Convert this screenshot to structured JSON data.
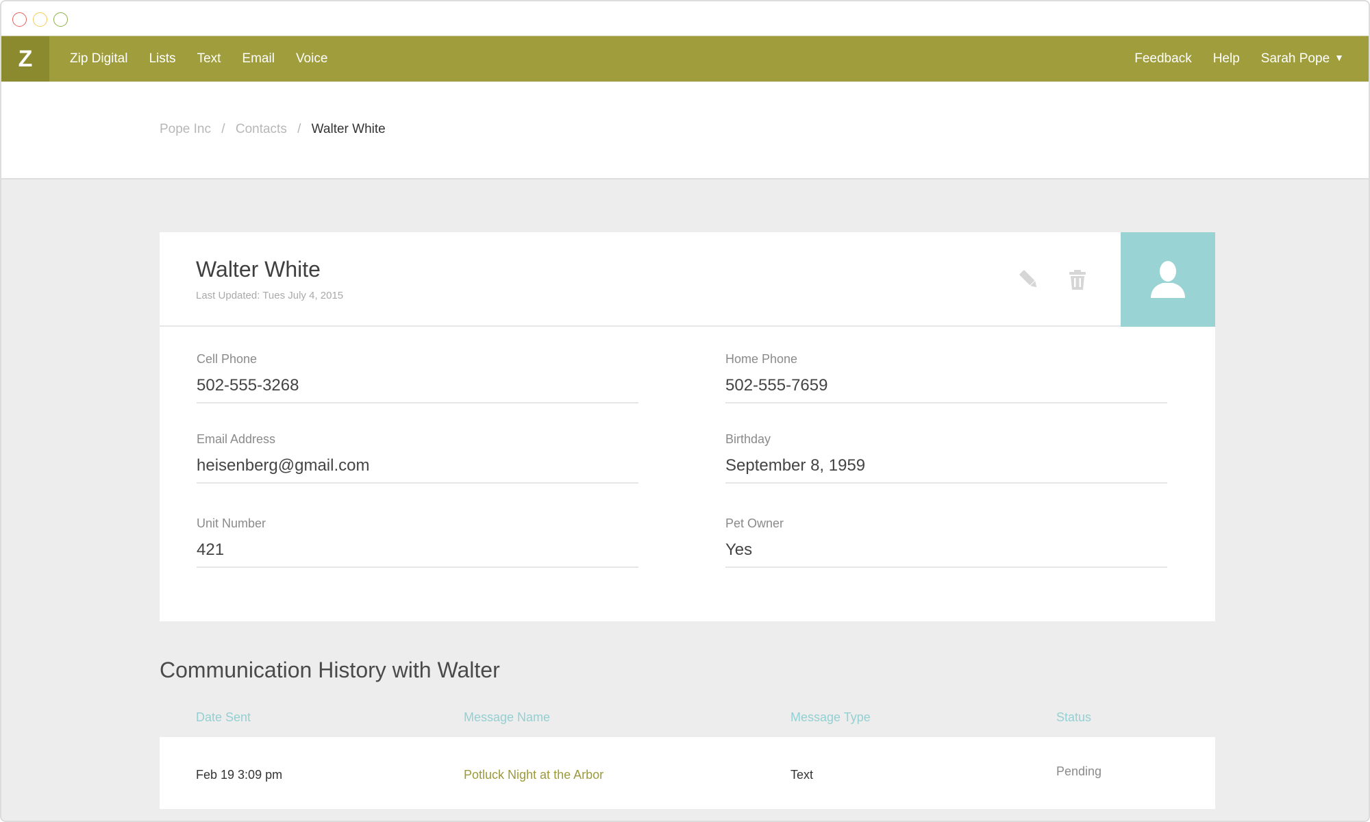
{
  "window": {
    "controls": [
      "close",
      "minimize",
      "maximize"
    ]
  },
  "nav": {
    "logo": "Z",
    "left_items": [
      {
        "label": "Zip Digital"
      },
      {
        "label": "Lists"
      },
      {
        "label": "Text"
      },
      {
        "label": "Email"
      },
      {
        "label": "Voice"
      }
    ],
    "right_items": {
      "feedback": "Feedback",
      "help": "Help",
      "user": "Sarah Pope",
      "user_caret": "▼"
    },
    "colors": {
      "bar": "#a09d3c",
      "logo_bg": "#8c8a2f"
    }
  },
  "breadcrumb": {
    "items": [
      "Pope Inc",
      "Contacts"
    ],
    "separator": "/",
    "current": "Walter White"
  },
  "contact": {
    "name": "Walter White",
    "last_updated": "Last Updated: Tues July 4, 2015",
    "actions": {
      "edit_icon": "pencil-icon",
      "delete_icon": "trash-icon"
    },
    "avatar": {
      "icon": "user-silhouette-icon",
      "bg_color": "#99d3d4"
    },
    "fields": {
      "cell_phone": {
        "label": "Cell Phone",
        "value": "502-555-3268"
      },
      "home_phone": {
        "label": "Home Phone",
        "value": "502-555-7659"
      },
      "email": {
        "label": "Email Address",
        "value": "heisenberg@gmail.com"
      },
      "birthday": {
        "label": "Birthday",
        "value": "September 8, 1959"
      },
      "unit_number": {
        "label": "Unit Number",
        "value": "421"
      },
      "pet_owner": {
        "label": "Pet Owner",
        "value": "Yes"
      }
    }
  },
  "history": {
    "title": "Communication History with Walter",
    "columns": [
      "Date Sent",
      "Message Name",
      "Message Type",
      "Status"
    ],
    "rows": [
      {
        "date_sent": "Feb 19 3:09 pm",
        "message_name": "Potluck Night at the Arbor",
        "message_type": "Text",
        "status": "Pending"
      }
    ],
    "colors": {
      "header": "#94d0d2",
      "message_link": "#9c9a38"
    }
  }
}
